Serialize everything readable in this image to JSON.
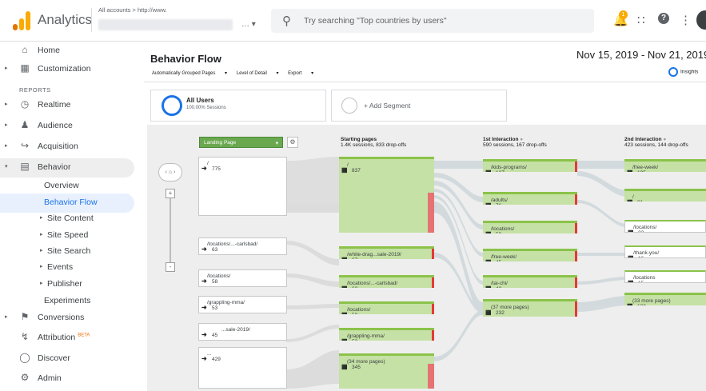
{
  "topbar": {
    "app_title": "Analytics",
    "account_path": "All accounts > http://www.",
    "search_placeholder": "Try searching \"Top countries by users\"",
    "notification_count": "1"
  },
  "sidebar": {
    "section_label": "REPORTS",
    "items": [
      {
        "label": "Home",
        "icon": "home-icon"
      },
      {
        "label": "Customization",
        "icon": "dashboard-icon"
      },
      {
        "label": "Realtime",
        "icon": "clock-icon"
      },
      {
        "label": "Audience",
        "icon": "person-icon"
      },
      {
        "label": "Acquisition",
        "icon": "acquisition-icon"
      },
      {
        "label": "Behavior",
        "icon": "behavior-icon"
      },
      {
        "label": "Overview"
      },
      {
        "label": "Behavior Flow"
      },
      {
        "label": "Site Content"
      },
      {
        "label": "Site Speed"
      },
      {
        "label": "Site Search"
      },
      {
        "label": "Events"
      },
      {
        "label": "Publisher"
      },
      {
        "label": "Experiments"
      },
      {
        "label": "Conversions",
        "icon": "flag-icon"
      },
      {
        "label": "Attribution",
        "badge": "BETA",
        "icon": "attribution-icon"
      },
      {
        "label": "Discover",
        "icon": "lightbulb-icon"
      },
      {
        "label": "Admin",
        "icon": "gear-icon"
      }
    ]
  },
  "report": {
    "title": "Behavior Flow",
    "date_range": "Nov 15, 2019 - Nov 21, 2019",
    "options": [
      "Automatically Grouped Pages",
      "Level of Detail",
      "Export"
    ],
    "insights": "Insights",
    "segment_primary": {
      "title": "All Users",
      "subtitle": "100.00% Sessions"
    },
    "segment_add": "+ Add Segment"
  },
  "flow": {
    "dimension": "Landing Page",
    "columns": [
      {
        "title": "Starting pages",
        "sub": "1.4K sessions, 833 drop-offs"
      },
      {
        "title": "1st Interaction",
        "sub": "590 sessions, 167 drop-offs"
      },
      {
        "title": "2nd Interaction",
        "sub": "423 sessions, 144 drop-offs"
      }
    ],
    "landing": [
      {
        "label": "/",
        "value": "775"
      },
      {
        "label": "/locations/...-carlsbad/",
        "value": "63"
      },
      {
        "label": "/locations/",
        "value": "58"
      },
      {
        "label": "/grappling-mma/",
        "value": "53"
      },
      {
        "label": "...sale-2019/",
        "value": "45"
      },
      {
        "label": "...",
        "value": "429"
      }
    ],
    "starting": [
      {
        "label": "/",
        "value": "837"
      },
      {
        "label": "/white-drag...sale-2019/",
        "value": "67"
      },
      {
        "label": "/locations/...-carlsbad/",
        "value": "63"
      },
      {
        "label": "/locations/",
        "value": "58"
      },
      {
        "label": "/grappling-mma/",
        "value": "53"
      },
      {
        "label": "(34 more pages)",
        "value": "345"
      }
    ],
    "first": [
      {
        "label": "/kids-programs/",
        "value": "137"
      },
      {
        "label": "/adults/",
        "value": "76"
      },
      {
        "label": "/locations/",
        "value": "58"
      },
      {
        "label": "/free-week/",
        "value": "45"
      },
      {
        "label": "/tai-chi/",
        "value": "42"
      },
      {
        "label": "(37 more pages)",
        "value": "232"
      }
    ],
    "second": [
      {
        "label": "/free-week/",
        "value": "105"
      },
      {
        "label": "/",
        "value": "81"
      },
      {
        "label": "/locations/",
        "value": "23"
      },
      {
        "label": "/thank-you/",
        "value": "16"
      },
      {
        "label": "/locations",
        "value": "15"
      },
      {
        "label": "(33 more pages)",
        "value": "183"
      }
    ]
  },
  "colors": {
    "accent": "#1a73e8",
    "node_green": "#8bc34a",
    "dropoff_red": "#e57373"
  }
}
